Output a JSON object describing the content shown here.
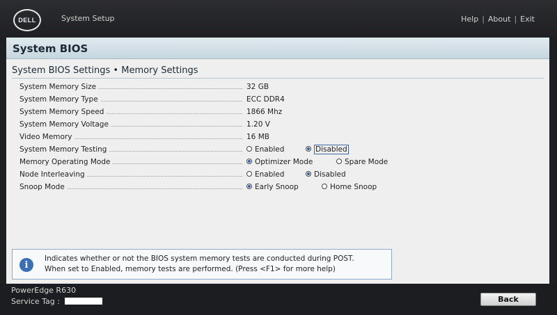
{
  "header": {
    "logo": "DELL",
    "app_title": "System Setup",
    "links": [
      "Help",
      "About",
      "Exit"
    ]
  },
  "section": {
    "title": "System BIOS"
  },
  "page": {
    "title": "System BIOS Settings • Memory Settings"
  },
  "settings": [
    {
      "label": "System Memory Size",
      "value": "32 GB"
    },
    {
      "label": "System Memory Type",
      "value": "ECC DDR4"
    },
    {
      "label": "System Memory Speed",
      "value": "1866 Mhz"
    },
    {
      "label": "System Memory Voltage",
      "value": "1.20 V"
    },
    {
      "label": "Video Memory",
      "value": "16 MB"
    },
    {
      "label": "System Memory Testing",
      "options": [
        "Enabled",
        "Disabled"
      ],
      "selected": "Disabled"
    },
    {
      "label": "Memory Operating Mode",
      "options": [
        "Optimizer Mode",
        "Spare Mode"
      ],
      "selected": "Optimizer Mode"
    },
    {
      "label": "Node Interleaving",
      "options": [
        "Enabled",
        "Disabled"
      ],
      "selected": "Disabled"
    },
    {
      "label": "Snoop Mode",
      "options": [
        "Early Snoop",
        "Home Snoop"
      ],
      "selected": "Early Snoop"
    }
  ],
  "help": {
    "icon": "info-icon",
    "line1": "Indicates whether or not the BIOS system memory tests are conducted during POST.",
    "line2": "When set to Enabled, memory tests are performed. (Press <F1> for more help)"
  },
  "footer": {
    "model": "PowerEdge R630",
    "service_tag_label": "Service Tag :",
    "back_label": "Back"
  },
  "colors": {
    "accent": "#2a5fa8",
    "section_bar": "#c7d6de",
    "chrome": "#1e1f22"
  }
}
